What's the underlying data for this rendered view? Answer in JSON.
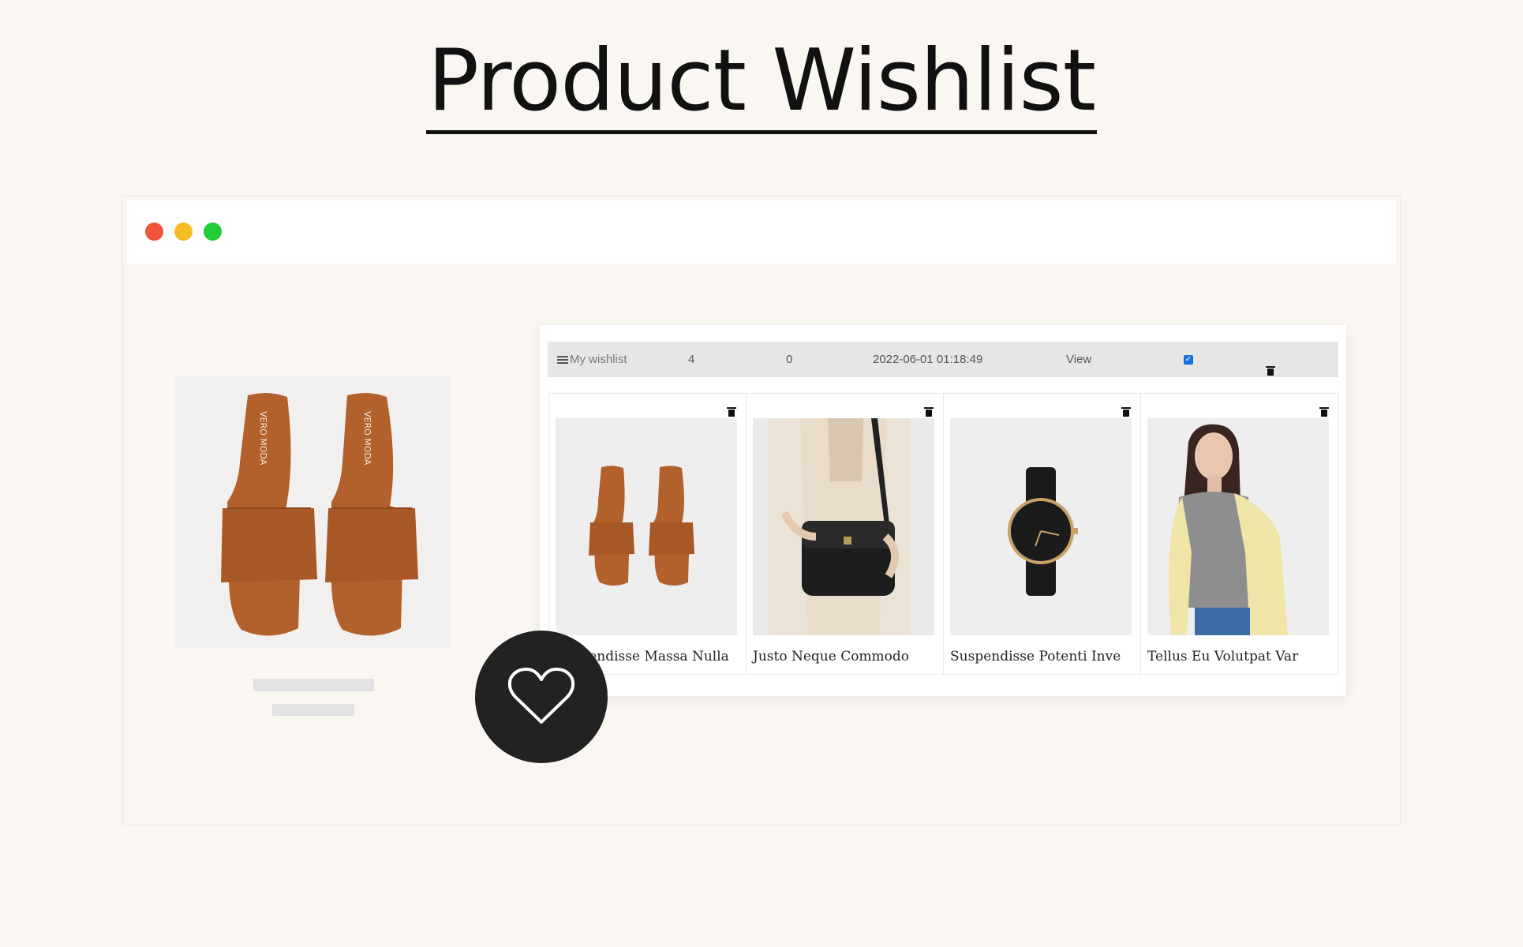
{
  "page": {
    "title": "Product Wishlist"
  },
  "wishlist": {
    "name": "My wishlist",
    "item_count": "4",
    "shared_count": "0",
    "date": "2022-06-01 01:18:49",
    "view_label": "View",
    "default_checked": true
  },
  "products": [
    {
      "name": "Suspendisse Massa Nulla",
      "image": "brown-slides"
    },
    {
      "name": "Justo Neque Commodo",
      "image": "black-handbag"
    },
    {
      "name": "Suspendisse Potenti Inve",
      "image": "black-watch"
    },
    {
      "name": "Tellus Eu Volutpat Var",
      "image": "woman-yellow-jacket"
    }
  ],
  "colors": {
    "background": "#faf7f2",
    "window_red": "#f1543a",
    "window_yellow": "#f5bd23",
    "window_green": "#22cc37",
    "slide_brown": "#b2612c",
    "fab": "#222222",
    "checkbox": "#1a6fe0"
  }
}
